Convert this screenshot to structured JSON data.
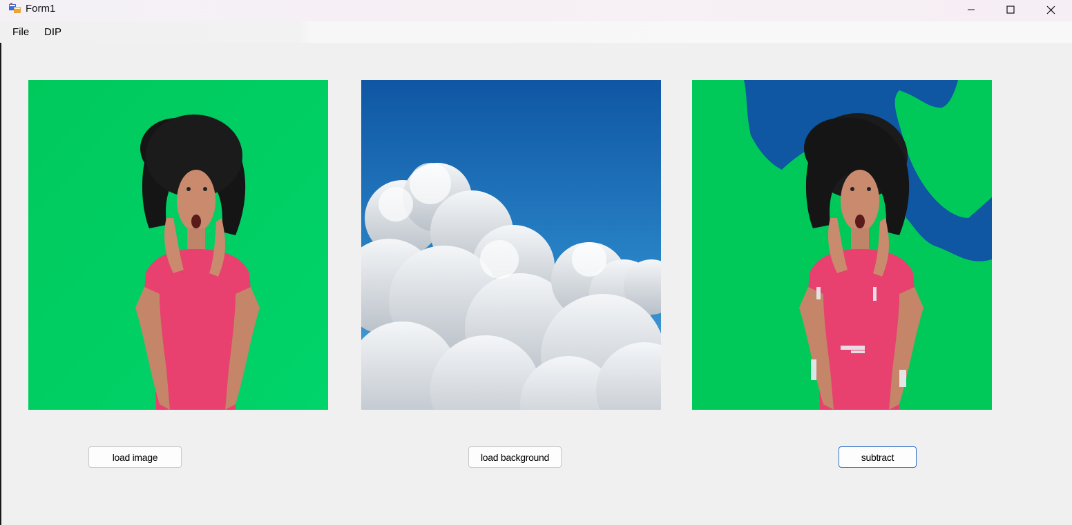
{
  "window": {
    "title": "Form1",
    "icon": "winforms-app-icon",
    "controls": [
      "minimize-icon",
      "maximize-icon",
      "close-icon"
    ]
  },
  "menu": {
    "items": [
      {
        "label": "File"
      },
      {
        "label": "DIP"
      }
    ]
  },
  "pictures": {
    "source": {
      "content": "woman-green-screen-photo"
    },
    "background": {
      "content": "sky-clouds-photo"
    },
    "result": {
      "content": "subtraction-result-photo"
    }
  },
  "buttons": {
    "load_image": "load image",
    "load_background": "load background",
    "subtract": "subtract"
  },
  "colors": {
    "green_screen": "#00c95a",
    "sky_blue": "#0f5aa8",
    "shirt_pink": "#e83f6f",
    "accent_focus": "#2e6fc9"
  }
}
